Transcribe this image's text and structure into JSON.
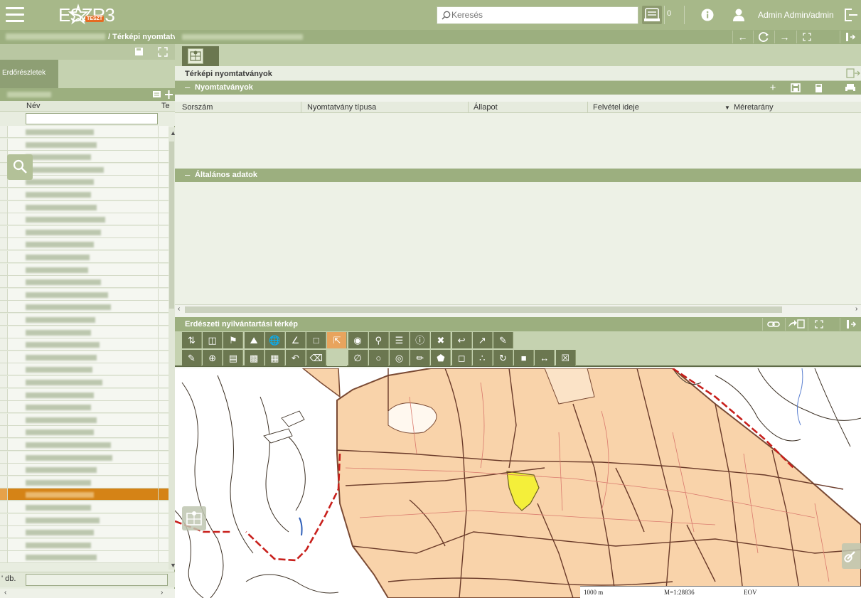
{
  "topbar": {
    "logo_text": "ESZR3",
    "logo_badge": "TESZT",
    "search_placeholder": "Keresés",
    "print_count": "0",
    "user_name": "Admin Admin/admin",
    "accent": "#a7b889"
  },
  "sidebar": {
    "title": "/ Térképi nyomtatv",
    "tab_label": "Erdőrészletek",
    "col_name": "Név",
    "col_type": "Te",
    "count_label": "' db.",
    "selected_row_color": "#d58316"
  },
  "main": {
    "panel_title": "Térképi nyomtatványok",
    "section_prints": {
      "label": "Nyomtatványok",
      "columns": [
        "Sorszám",
        "Nyomtatvány típusa",
        "Állapot",
        "Felvétel ideje",
        "Méretarány"
      ]
    },
    "section_general": {
      "label": "Általános adatok"
    },
    "map_section": {
      "label": "Erdészeti nyilvántartási térkép"
    },
    "map_scale": {
      "distance": "1000 m",
      "ratio": "M=1:28836",
      "projection": "EOV"
    }
  },
  "icons": {
    "menu": "hamburger-icon",
    "search": "search-icon",
    "print": "print-queue-icon",
    "info": "info-icon",
    "user": "user-icon",
    "logout": "logout-icon"
  }
}
